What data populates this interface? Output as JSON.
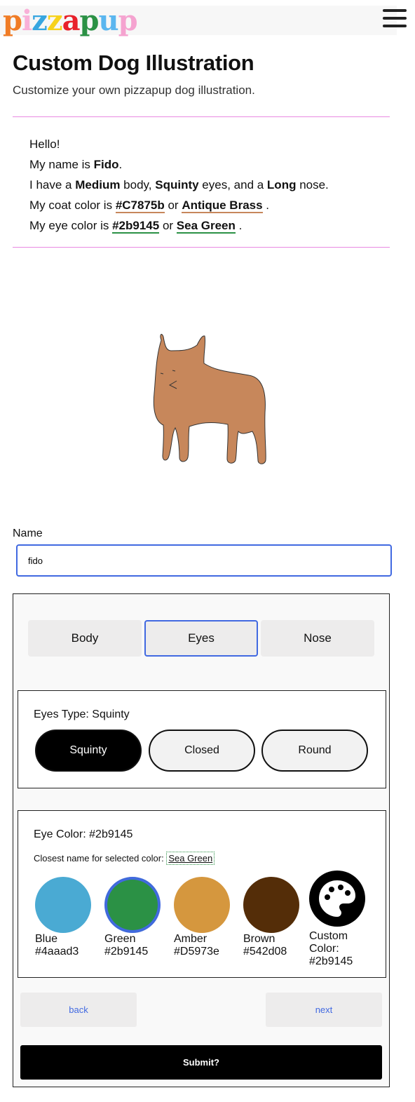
{
  "header": {
    "logo": {
      "letters": [
        "p",
        "i",
        "z",
        "z",
        "a",
        "p",
        "u",
        "p"
      ],
      "colors": [
        "#f07c26",
        "#f9b0d8",
        "#37a6e0",
        "#f7d21c",
        "#e8202a",
        "#2b9145",
        "#5ab6ef",
        "#f5a3d0"
      ]
    },
    "menu_icon": "hamburger-icon"
  },
  "page": {
    "title": "Custom Dog Illustration",
    "subtitle": "Customize your own pizzapup dog illustration."
  },
  "intro": {
    "hello": "Hello!",
    "name_prefix": "My name is ",
    "name": "Fido",
    "name_suffix": ".",
    "have_prefix": "I have a ",
    "body": "Medium",
    "body_suffix": " body, ",
    "eyes": "Squinty",
    "eyes_suffix": " eyes, and a ",
    "nose": "Long",
    "nose_suffix": " nose.",
    "coat_prefix": "My coat color is ",
    "coat_hex": "#C7875b",
    "or": " or ",
    "coat_name": "Antique Brass",
    "period": ".",
    "eye_prefix": "My eye color is ",
    "eye_hex": "#2b9145",
    "eye_name": "Sea Green"
  },
  "dog": {
    "coat_color": "#c7875b"
  },
  "form": {
    "name_label": "Name",
    "name_value": "fido"
  },
  "tabs": [
    {
      "label": "Body",
      "active": false
    },
    {
      "label": "Eyes",
      "active": true
    },
    {
      "label": "Nose",
      "active": false
    }
  ],
  "eyes_type": {
    "title": "Eyes Type: Squinty",
    "options": [
      {
        "label": "Squinty",
        "active": true
      },
      {
        "label": "Closed",
        "active": false
      },
      {
        "label": "Round",
        "active": false
      }
    ]
  },
  "eye_color": {
    "title": "Eye Color: #2b9145",
    "closest_label": "Closest name for selected color:",
    "closest_name": "Sea Green",
    "swatches": [
      {
        "name": "Blue",
        "hex": "#4aaad3",
        "color": "#4aaad3"
      },
      {
        "name": "Green",
        "hex": "#2b9145",
        "color": "#2b9145",
        "selected": true
      },
      {
        "name": "Amber",
        "hex": "#D5973e",
        "color": "#d5973e"
      },
      {
        "name": "Brown",
        "hex": "#542d08",
        "color": "#542d08"
      }
    ],
    "custom": {
      "line1": "Custom",
      "line2": "Color:",
      "hex": "#2b9145",
      "icon": "palette-icon"
    }
  },
  "nav": {
    "back": "back",
    "next": "next",
    "submit": "Submit?"
  }
}
